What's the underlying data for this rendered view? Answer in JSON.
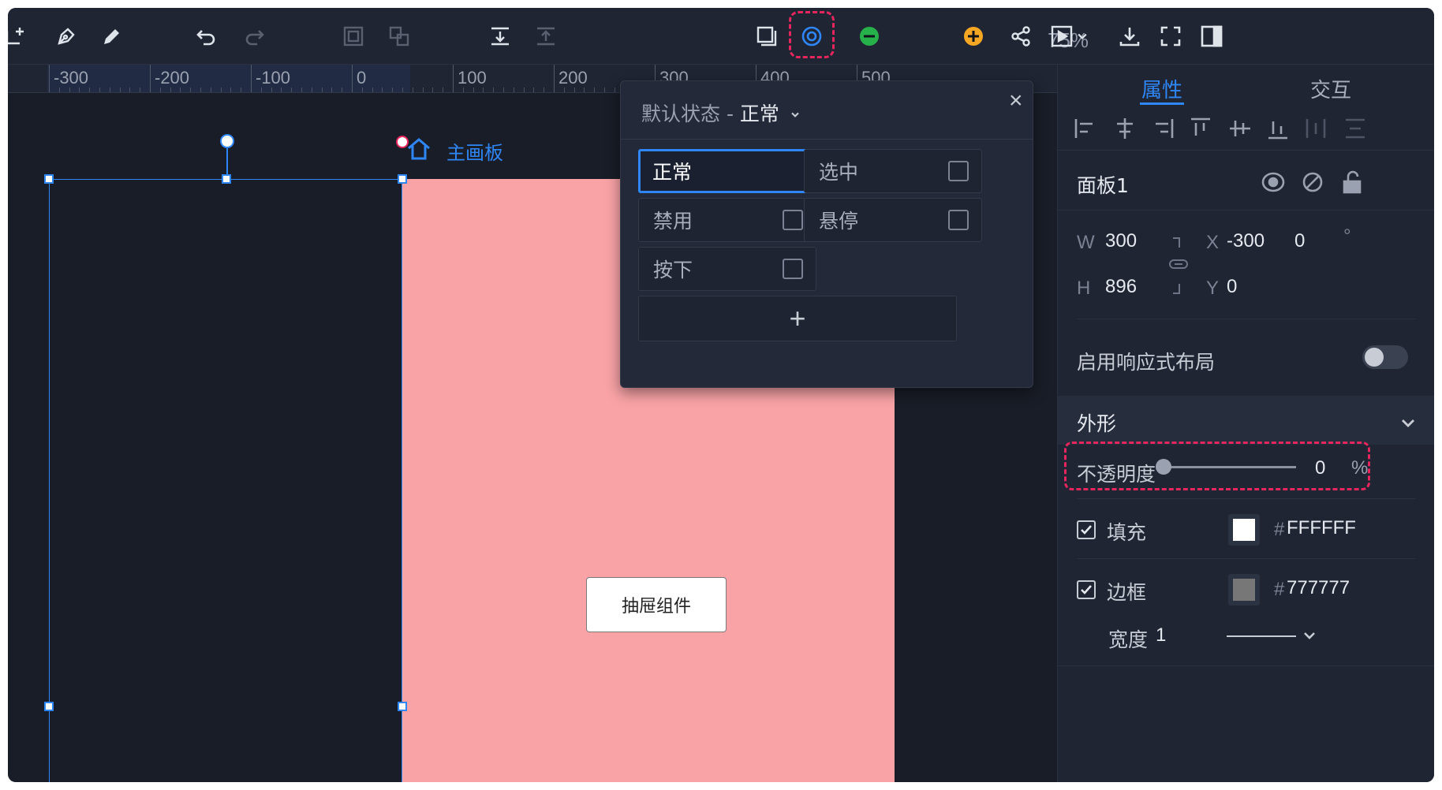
{
  "toolbar": {
    "zoom": "75%",
    "highlighted_tool": "state-target-icon"
  },
  "ruler": {
    "labels": [
      "-300",
      "-200",
      "-100",
      "0",
      "100",
      "200",
      "300",
      "400",
      "500"
    ]
  },
  "canvas": {
    "board_label": "主画板",
    "drawer_button_label": "抽屉组件",
    "board_color": "#f9a3a6"
  },
  "state_popup": {
    "title_prefix": "默认状态 - ",
    "title_value": "正常",
    "states": [
      {
        "label": "正常",
        "active": true,
        "checkbox": false
      },
      {
        "label": "选中",
        "active": false,
        "checkbox": true
      },
      {
        "label": "禁用",
        "active": false,
        "checkbox": true
      },
      {
        "label": "悬停",
        "active": false,
        "checkbox": true
      },
      {
        "label": "按下",
        "active": false,
        "checkbox": true
      }
    ],
    "add_label": "+",
    "close_label": "×"
  },
  "panel": {
    "tabs": [
      "属性",
      "交互"
    ],
    "name": "面板1",
    "geometry": {
      "w_label": "W",
      "w": "300",
      "h_label": "H",
      "h": "896",
      "x_label": "X",
      "x": "-300",
      "y_label": "Y",
      "y": "0",
      "rotation": "0",
      "rotation_unit": "°"
    },
    "responsive_label": "启用响应式布局",
    "responsive_enabled": false,
    "appearance_title": "外形",
    "opacity": {
      "label": "不透明度",
      "value": "0",
      "unit": "%"
    },
    "fill": {
      "label": "填充",
      "checked": true,
      "hash": "#",
      "hex": "FFFFFF",
      "color": "#ffffff"
    },
    "border": {
      "label": "边框",
      "checked": true,
      "hash": "#",
      "hex": "777777",
      "color": "#777777"
    },
    "border_width": {
      "label": "宽度",
      "value": "1"
    }
  },
  "colors": {
    "accent": "#2f86f6",
    "highlight": "#e8265e"
  }
}
